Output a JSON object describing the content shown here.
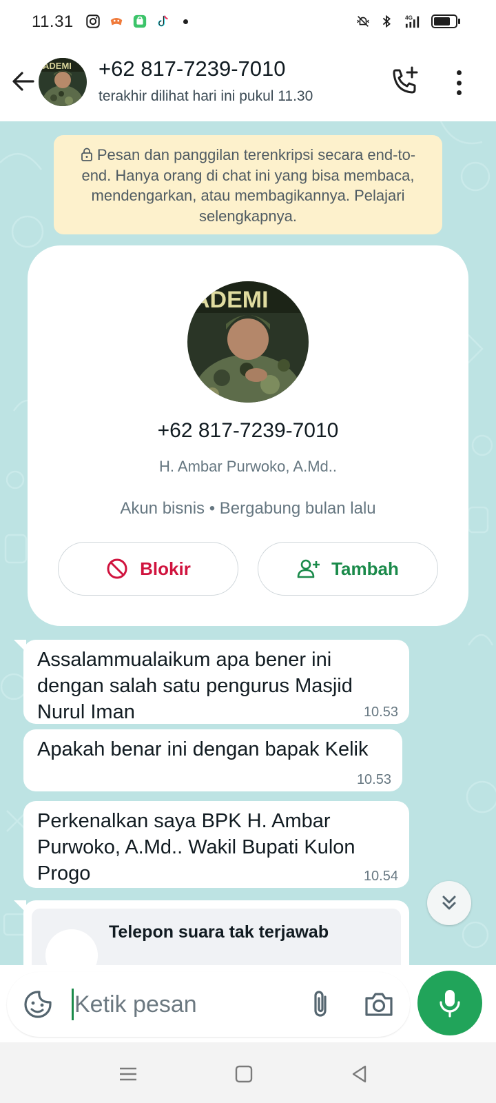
{
  "status_bar": {
    "time": "11.31",
    "network": "4G",
    "left_icons": [
      "instagram-icon",
      "game-icon",
      "store-icon",
      "tiktok-icon",
      "notification-dot"
    ],
    "right_icons": [
      "vibrate-silent-icon",
      "bluetooth-icon",
      "signal-4g-icon",
      "battery-icon"
    ],
    "battery_level": 0.8
  },
  "header": {
    "title": "+62 817-7239-7010",
    "subtitle": "terakhir dilihat hari ini pukul 11.30",
    "icons": [
      "back-arrow-icon",
      "add-call-icon",
      "more-vert-icon"
    ]
  },
  "chat": {
    "encryption_notice": "Pesan dan panggilan terenkripsi secara end-to-end. Hanya orang di chat ini yang bisa membaca, mendengarkan, atau membagikannya. Pelajari selengkapnya.",
    "profile_card": {
      "phone": "+62 817-7239-7010",
      "name": "H. Ambar Purwoko, A.Md..",
      "info": "Akun bisnis • Bergabung bulan lalu",
      "block_label": "Blokir",
      "add_label": "Tambah"
    },
    "messages": [
      {
        "text": "Assalammualaikum apa bener ini dengan salah satu pengurus Masjid Nurul Iman",
        "time": "10.53"
      },
      {
        "text": "Apakah benar ini dengan bapak Kelik",
        "time": "10.53"
      },
      {
        "text": "Perkenalkan saya BPK H. Ambar Purwoko, A.Md..  Wakil Bupati Kulon Progo",
        "time": "10.54"
      }
    ],
    "missed_call": {
      "title": "Telepon suara tak terjawab"
    }
  },
  "input": {
    "placeholder": "Ketik pesan",
    "value": ""
  },
  "colors": {
    "accent_green": "#21a45a",
    "block_red": "#d0133e",
    "chat_background": "#bde3e3",
    "notice_background": "#fdf1cc"
  }
}
